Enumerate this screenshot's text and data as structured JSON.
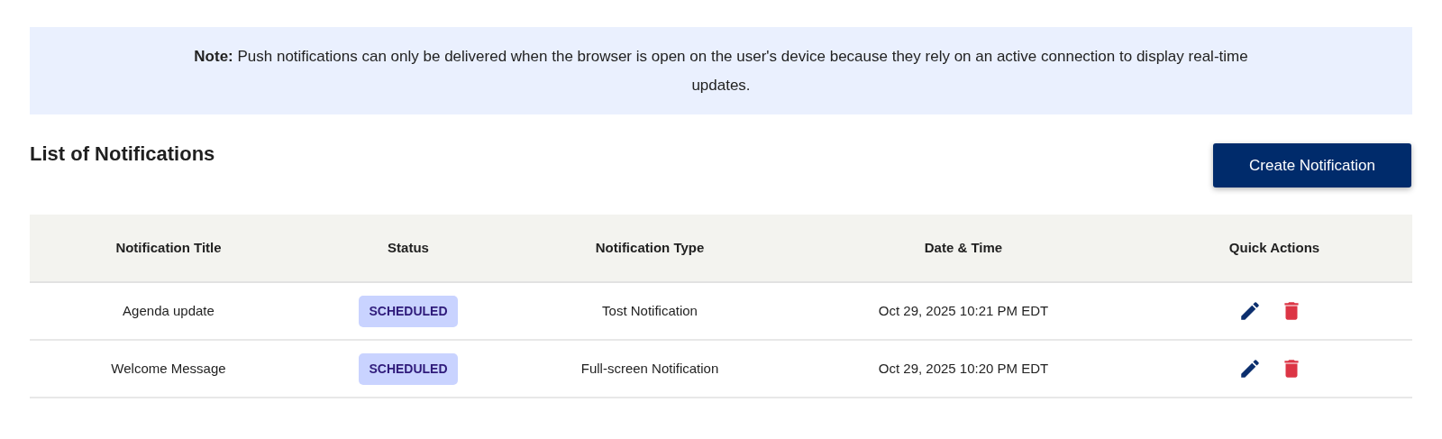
{
  "note": "**Note:** Push notifications can only be delivered when the browser is open on the user's device because they rely on an active connection to display real-time updates.",
  "heading": "List of Notifications",
  "create_button": "Create Notification",
  "table": {
    "columns": [
      "Notification Title",
      "Status",
      "Notification Type",
      "Date & Time",
      "Quick Actions"
    ],
    "rows": [
      {
        "title": "Agenda update",
        "status": "SCHEDULED",
        "type": "Tost Notification",
        "datetime": "Oct 29, 2025 10:21 PM EDT"
      },
      {
        "title": "Welcome Message",
        "status": "SCHEDULED",
        "type": "Full-screen Notification",
        "datetime": "Oct 29, 2025 10:20 PM EDT"
      }
    ]
  }
}
